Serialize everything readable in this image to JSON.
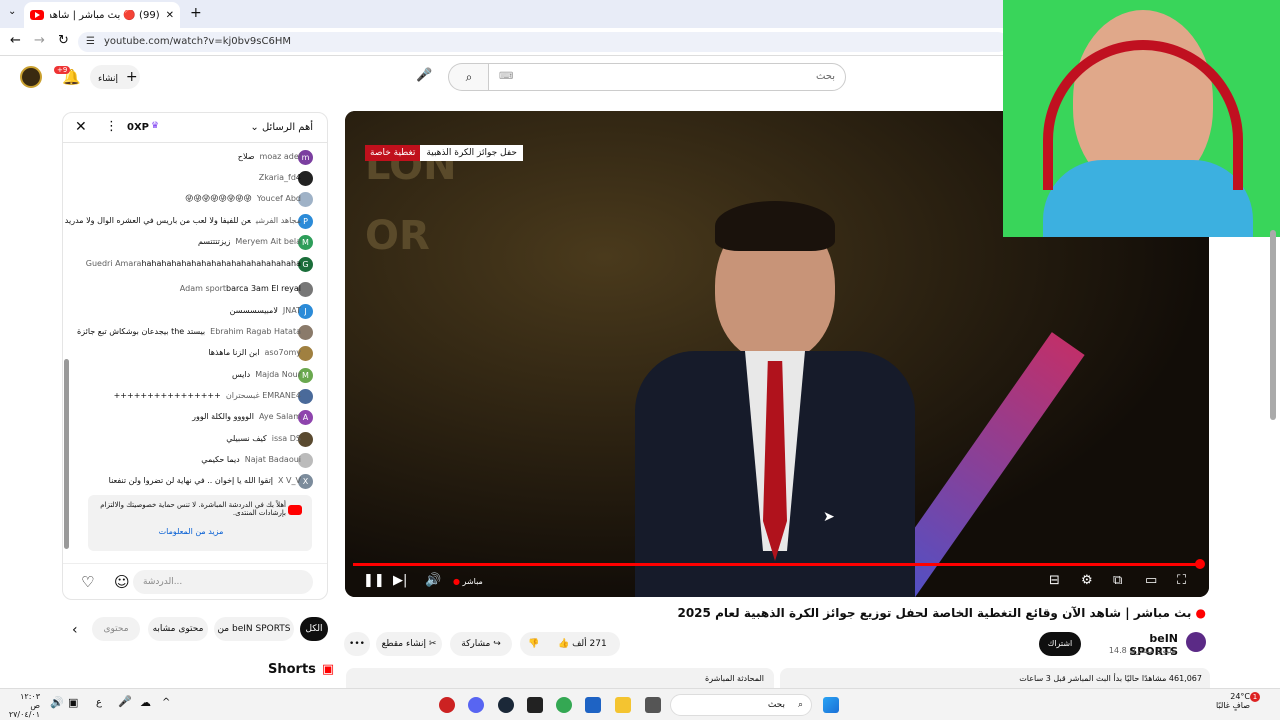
{
  "browser": {
    "tab_title": "(99) 🔴 بث مباشر | شاهد الآ...",
    "url": "youtube.com/watch?v=kj0bv9sC6HM"
  },
  "masthead": {
    "create_label": "إنشاء",
    "notif_badge": "+9",
    "search_placeholder": "بحث"
  },
  "chat": {
    "header_title": "أهم الرسائل",
    "xp_label": "0XP",
    "messages": [
      {
        "author": "moaz adel",
        "text": "صلاح",
        "initial": "m",
        "color": "#7b3fa0"
      },
      {
        "author": "Zkaria_fd",
        "text": "4",
        "initial": "",
        "color": "#222"
      },
      {
        "author": "Youcef Abd",
        "text": "😜😜😜😜😜😜😜😜",
        "initial": "",
        "color": "#9fb2c7"
      },
      {
        "author": "مجاهد الفرشي",
        "text": "عن للفيفا ولا لعب من باريس في العشره الوال ولا مدريد",
        "initial": "P",
        "color": "#2b8bd8"
      },
      {
        "author": "Meryem Ait bela",
        "text": "زيزتتتتسم",
        "initial": "M",
        "color": "#2e9e5a"
      },
      {
        "author": "Guedri Amara",
        "text": "hahahahahahahahahahahahahahahaha",
        "initial": "G",
        "color": "#1b6e3a"
      },
      {
        "author": "Adam sport",
        "text": "barca 3am El reyal",
        "initial": "",
        "color": "#777"
      },
      {
        "author": "JNAT",
        "text": "لامبيسسسسن",
        "initial": "J",
        "color": "#2b8bd8"
      },
      {
        "author": "Ebrahim Ragab Hatata",
        "text": "بيستد the بيجدعان بوشكاش تبع جائزة",
        "initial": "",
        "color": "#8a7a6a"
      },
      {
        "author": "aso7omy",
        "text": "ابن الزنا ماهذها",
        "initial": "",
        "color": "#a08040"
      },
      {
        "author": "Majda Nour",
        "text": "دايس",
        "initial": "M",
        "color": "#6aa84f"
      },
      {
        "author": "EMRANE4 غبسحتران",
        "text": "++++++++++++++++",
        "initial": "",
        "color": "#4a6a9a"
      },
      {
        "author": "Aye Salam",
        "text": "الوووو والكلة الوور",
        "initial": "A",
        "color": "#8e44ad"
      },
      {
        "author": "issa DS",
        "text": "كيف نسبيلي",
        "initial": "",
        "color": "#5a4a30"
      },
      {
        "author": "Najat Badaoui",
        "text": "ديما حكيمي",
        "initial": "",
        "color": "#bbb"
      },
      {
        "author": "X V_V",
        "text": "إتقوا الله يا إخوان .. في نهاية لن تضروا ولن تنفعنا",
        "initial": "X",
        "color": "#7c8c9c"
      }
    ],
    "notice_text": "أهلاً بك في الدردشة المباشرة. لا تنس حماية خصوصيتك والالتزام بإرشادات المنتدى.",
    "notice_link": "مزيد من المعلومات",
    "input_placeholder": "الدردشة..."
  },
  "video": {
    "banner_main": "حفل جوائز الكرة الذهبية",
    "banner_tag": "تغطية خاصة",
    "live_label": "مباشر",
    "progress": 1.0
  },
  "info": {
    "title": "بث مباشر | شاهد الآن وقائع التغطية الخاصة لحفل توزيع جوائز الكرة الذهبية لعام 2025",
    "channel": "beIN SPORTS",
    "subscribers": "14.8 مليون مشترك",
    "subscribe_label": "اشتراك",
    "likes": "271 ألف",
    "share_label": "مشاركة",
    "clip_label": "إنشاء مقطع",
    "views": "461,067 مشاهدًا حاليًا  بدأ البث المباشر قبل 3 ساعات",
    "live_chat_label": "المحادثة المباشرة"
  },
  "filters": [
    "الكل",
    "من beIN SPORTS",
    "محتوى مشابه",
    "محتوى مقترح"
  ],
  "shorts_label": "Shorts",
  "taskbar": {
    "search_label": "بحث",
    "weather_temp": "24°C",
    "weather_text": "صافٍ غالبًا",
    "time": "١٢:٠٣ ص",
    "date": "٢٧/٠٤/٠١",
    "lang": "ع"
  }
}
